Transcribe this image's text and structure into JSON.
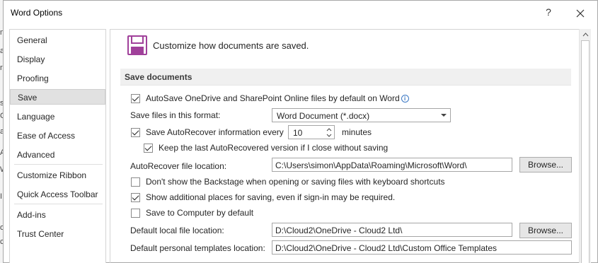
{
  "background_text": [
    "n",
    "a",
    "ra",
    "",
    "s",
    "C",
    "a",
    "A",
    "W",
    "",
    "I",
    "",
    "o",
    "c"
  ],
  "dialog": {
    "title": "Word Options",
    "help": "?",
    "close_icon": "close-icon"
  },
  "sidebar": {
    "items": [
      {
        "label": "General",
        "active": false
      },
      {
        "label": "Display",
        "active": false
      },
      {
        "label": "Proofing",
        "active": false
      },
      {
        "label": "Save",
        "active": true
      },
      {
        "label": "Language",
        "active": false
      },
      {
        "label": "Ease of Access",
        "active": false
      },
      {
        "label": "Advanced",
        "active": false
      },
      {
        "label": "Customize Ribbon",
        "active": false
      },
      {
        "label": "Quick Access Toolbar",
        "active": false
      },
      {
        "label": "Add-ins",
        "active": false
      },
      {
        "label": "Trust Center",
        "active": false
      }
    ]
  },
  "main": {
    "header_icon": "save-floppy-icon",
    "header_text": "Customize how documents are saved.",
    "section_title": "Save documents",
    "autosave": {
      "label": "AutoSave OneDrive and SharePoint Online files by default on Word",
      "checked": true
    },
    "format": {
      "label": "Save files in this format:",
      "value": "Word Document (*.docx)"
    },
    "autorecover": {
      "label": "Save AutoRecover information every",
      "checked": true,
      "minutes": "10",
      "unit": "minutes"
    },
    "keep_last": {
      "label": "Keep the last AutoRecovered version if I close without saving",
      "checked": true
    },
    "autorecover_location": {
      "label": "AutoRecover file location:",
      "value": "C:\\Users\\simon\\AppData\\Roaming\\Microsoft\\Word\\",
      "browse": "Browse..."
    },
    "backstage": {
      "label": "Don't show the Backstage when opening or saving files with keyboard shortcuts",
      "checked": false
    },
    "additional_places": {
      "label": "Show additional places for saving, even if sign-in may be required.",
      "checked": true
    },
    "save_to_computer": {
      "label": "Save to Computer by default",
      "checked": false
    },
    "default_local": {
      "label": "Default local file location:",
      "value": "D:\\Cloud2\\OneDrive - Cloud2 Ltd\\",
      "browse": "Browse..."
    },
    "default_templates": {
      "label": "Default personal templates location:",
      "value": "D:\\Cloud2\\OneDrive - Cloud2 Ltd\\Custom Office Templates"
    }
  },
  "colors": {
    "accent": "#3b78c4",
    "floppy": "#a0409a",
    "active_nav": "#e1e1e1"
  }
}
